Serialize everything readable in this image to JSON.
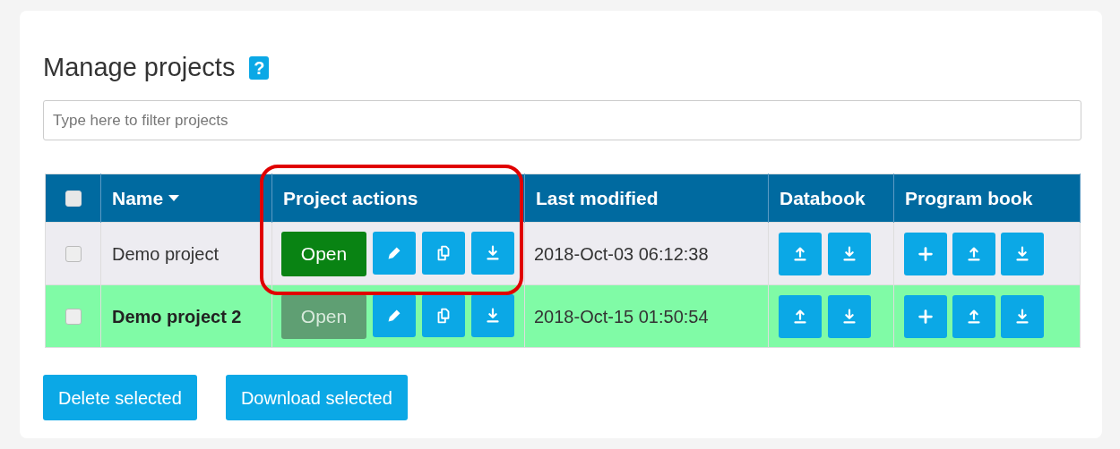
{
  "title": "Manage projects",
  "help_icon": "?",
  "filter": {
    "placeholder": "Type here to filter projects"
  },
  "table": {
    "header_checkbox": {
      "checked": false
    },
    "columns": [
      {
        "label": "Name",
        "sorted": true
      },
      {
        "label": "Project actions"
      },
      {
        "label": "Last modified"
      },
      {
        "label": "Databook"
      },
      {
        "label": "Program book"
      }
    ],
    "rows": [
      {
        "name": "Demo project",
        "open": {
          "label": "Open",
          "disabled": false
        },
        "last_modified": "2018-Oct-03 06:12:38",
        "checked": false,
        "selected": false
      },
      {
        "name": "Demo project 2",
        "open": {
          "label": "Open",
          "disabled": true
        },
        "last_modified": "2018-Oct-15 01:50:54",
        "checked": false,
        "selected": true
      }
    ]
  },
  "buttons": [
    "Delete selected",
    "Download selected"
  ]
}
